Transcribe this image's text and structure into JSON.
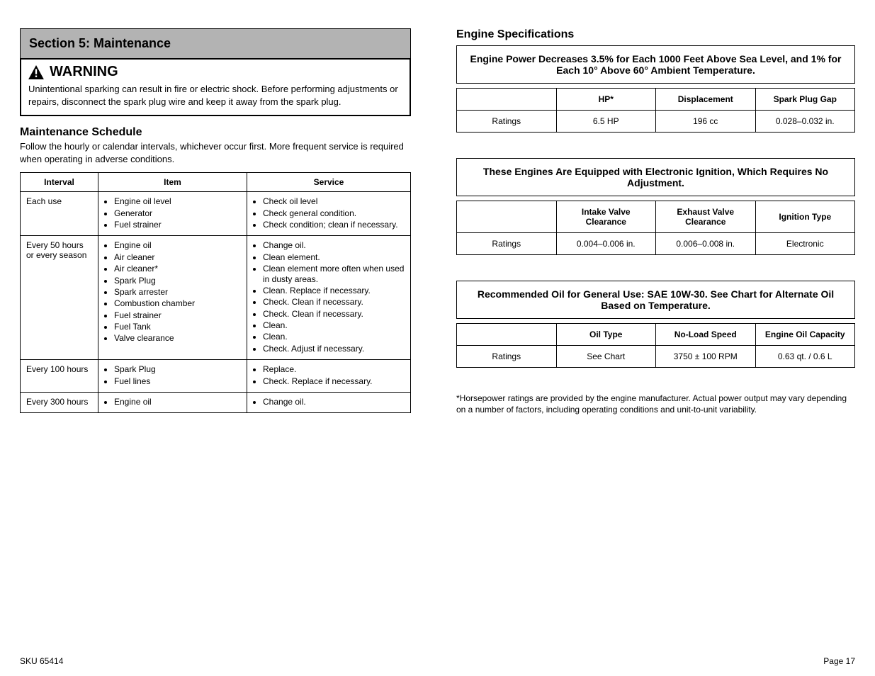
{
  "section_title": "Section 5: Maintenance",
  "warning": {
    "label": "WARNING",
    "body": "Unintentional sparking can result in fire or electric shock. Before performing adjustments or repairs, disconnect the spark plug wire and keep it away from the spark plug."
  },
  "maint_schedule": {
    "heading": "Maintenance Schedule",
    "intro": "Follow the hourly or calendar intervals, whichever occur first. More frequent service is required when operating in adverse conditions.",
    "headers": {
      "interval": "Interval",
      "item": "Item",
      "service": "Service"
    },
    "rows": [
      {
        "interval": "Each use",
        "items": [
          "Engine oil level",
          "Generator",
          "Fuel strainer"
        ],
        "services": [
          "Check oil level",
          "Check general condition.",
          "Check condition; clean if necessary."
        ]
      },
      {
        "interval": "Every 50 hours or every season",
        "items": [
          "Engine oil",
          "Air cleaner",
          "Air cleaner*",
          "Spark Plug",
          "Spark arrester",
          "Combustion chamber",
          "Fuel strainer",
          "Fuel Tank",
          "Valve clearance"
        ],
        "services": [
          "Change oil.",
          "Clean element.",
          "Clean element more often when used in dusty areas.",
          "Clean. Replace if necessary.",
          "Check. Clean if necessary.",
          "Check. Clean if necessary.",
          "Clean.",
          "Clean.",
          "Check. Adjust if necessary."
        ]
      },
      {
        "interval": "Every 100 hours",
        "items": [
          "Spark Plug",
          "Fuel lines"
        ],
        "services": [
          "Replace.",
          "Check. Replace if necessary."
        ]
      },
      {
        "interval": "Every 300 hours",
        "items": [
          "Engine oil"
        ],
        "services": [
          "Change oil."
        ]
      }
    ]
  },
  "specs": {
    "heading": "Engine Specifications",
    "blocks": [
      {
        "title": "Engine Power Decreases 3.5% for Each 1000 Feet Above Sea Level, and 1% for Each 10° Above 60° Ambient Temperature.",
        "headers": [
          null,
          "HP*",
          "Displacement",
          "Spark Plug Gap"
        ],
        "row": [
          "Ratings",
          "6.5 HP",
          "196 cc",
          "0.028–0.032 in."
        ]
      },
      {
        "title": "These Engines Are Equipped with Electronic Ignition, Which Requires No Adjustment.",
        "headers": [
          null,
          "Intake Valve Clearance",
          "Exhaust Valve Clearance",
          "Ignition Type"
        ],
        "row": [
          "Ratings",
          "0.004–0.006 in.",
          "0.006–0.008 in.",
          "Electronic"
        ]
      },
      {
        "title": "Recommended Oil for General Use: SAE 10W-30. See Chart for Alternate Oil Based on Temperature.",
        "headers": [
          null,
          "Oil Type",
          "No-Load Speed",
          "Engine Oil Capacity"
        ],
        "row": [
          "Ratings",
          "See Chart",
          "3750 ± 100 RPM",
          "0.63 qt. / 0.6 L"
        ]
      }
    ],
    "chart_note": "*Horsepower ratings are provided by the engine manufacturer. Actual power output may vary depending on a number of factors, including operating conditions and unit-to-unit variability."
  },
  "footer": {
    "left": "SKU 65414",
    "right": "Page 17"
  }
}
